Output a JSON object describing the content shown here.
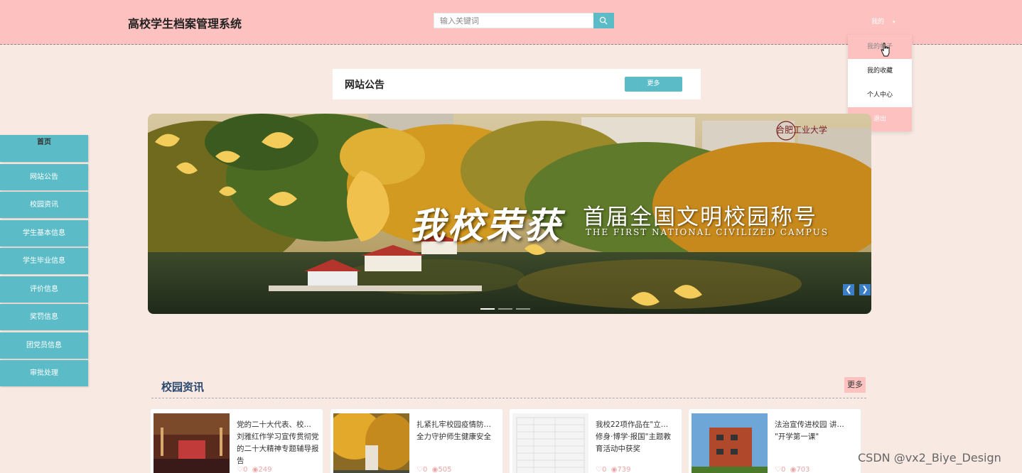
{
  "header": {
    "site_title": "高校学生档案管理系统",
    "search_placeholder": "输入关键词",
    "user_menu_label": "我的",
    "user_menu_caret": "▾"
  },
  "dropdown": {
    "items": [
      "我的帖子",
      "我的收藏",
      "个人中心",
      "退出"
    ]
  },
  "notice": {
    "title": "网站公告",
    "more_label": "更多"
  },
  "sidebar": {
    "items": [
      "首页",
      "网站公告",
      "校园资讯",
      "学生基本信息",
      "学生毕业信息",
      "评价信息",
      "奖罚信息",
      "团党员信息",
      "审批处理"
    ]
  },
  "banner": {
    "title": "我校荣获",
    "subtitle": "首届全国文明校园称号",
    "subtitle_en": "THE FIRST NATIONAL CIVILIZED CAMPUS",
    "logo_text": "合肥工业大学",
    "slide_count": 3,
    "active_slide": 1
  },
  "news": {
    "title": "校园资讯",
    "more_label": "更多",
    "items": [
      {
        "text": "党的二十大代表、校… 刘雅红作学习宣传贯彻党的二十大精神专题辅导报告",
        "likes": "0",
        "views": "249"
      },
      {
        "text": "扎紧扎牢校园疫情防… 全力守护师生健康安全",
        "likes": "0",
        "views": "505"
      },
      {
        "text": "我校22项作品在\"立… 修身·博学·报国\"主题教育活动中获奖",
        "likes": "0",
        "views": "739"
      },
      {
        "text": "法治宣传进校园 讲… \"开学第一课\"",
        "likes": "0",
        "views": "703"
      }
    ]
  },
  "watermark": "CSDN @vx2_Biye_Design",
  "colors": {
    "header_bg": "#fdc1bf",
    "accent": "#5bbcc7",
    "page_bg": "#f8e9e3"
  }
}
